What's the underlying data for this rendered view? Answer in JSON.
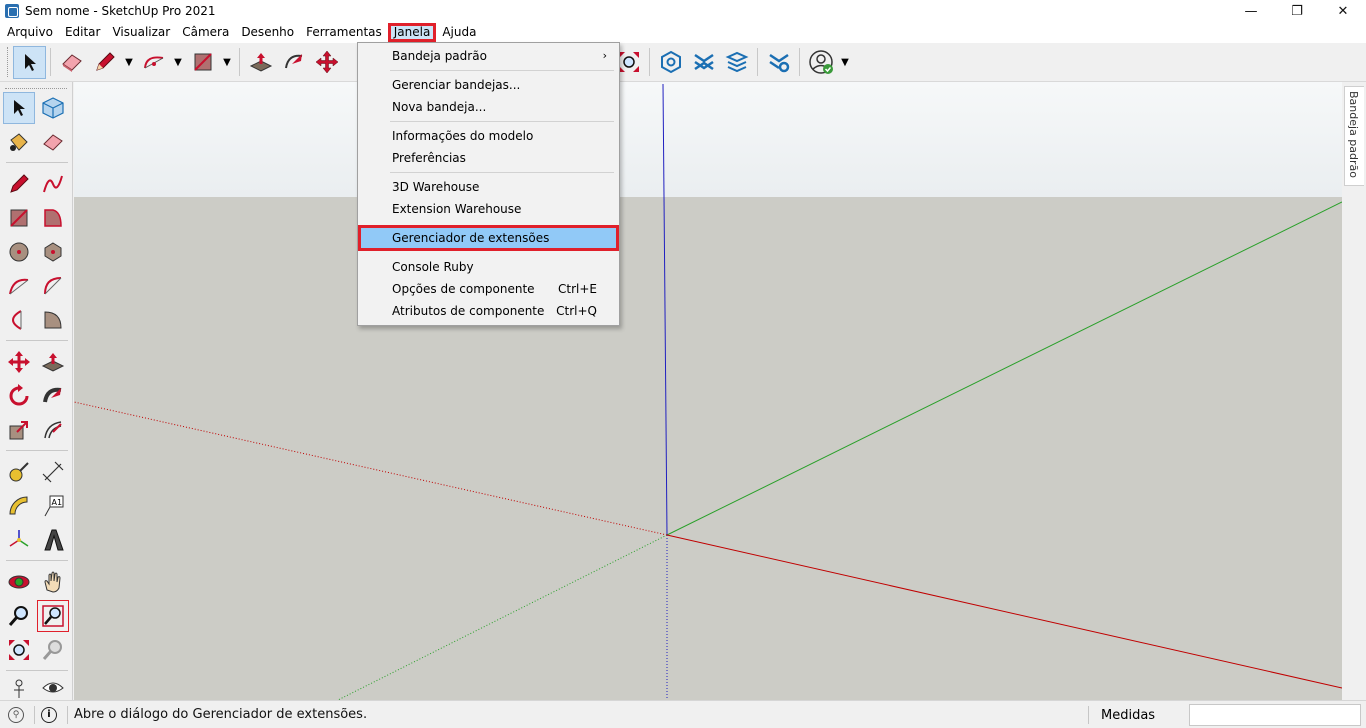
{
  "window": {
    "title": "Sem nome - SketchUp Pro 2021",
    "minimize": "—",
    "restore": "❐",
    "close": "✕"
  },
  "menubar": {
    "items": [
      "Arquivo",
      "Editar",
      "Visualizar",
      "Câmera",
      "Desenho",
      "Ferramentas",
      "Janela",
      "Ajuda"
    ],
    "open_menu": "Janela"
  },
  "janela_menu": {
    "items": [
      {
        "label": "Bandeja padrão",
        "submenu": "›"
      },
      {
        "label": "Gerenciar bandejas..."
      },
      {
        "label": "Nova bandeja..."
      },
      {
        "label": "Informações do modelo"
      },
      {
        "label": "Preferências"
      },
      {
        "label": "3D Warehouse"
      },
      {
        "label": "Extension Warehouse"
      },
      {
        "label": "Gerenciador de extensões",
        "highlighted": true
      },
      {
        "label": "Console Ruby"
      },
      {
        "label": "Opções de componente",
        "shortcut": "Ctrl+E"
      },
      {
        "label": "Atributos de componente",
        "shortcut": "Ctrl+Q"
      }
    ]
  },
  "right_tray": {
    "tab_label": "Bandeja padrão"
  },
  "statusbar": {
    "message": "Abre o diálogo do Gerenciador de extensões.",
    "info_icon": "i",
    "measurements_label": "Medidas",
    "measurements_value": ""
  },
  "colors": {
    "highlight_outline": "#e0202b",
    "menu_highlight": "#91c9f7",
    "axis_red": "#c00000",
    "axis_green": "#2aa02a",
    "axis_blue": "#2020c0",
    "ground": "#ccccc6",
    "sky": "#eef1f3"
  }
}
